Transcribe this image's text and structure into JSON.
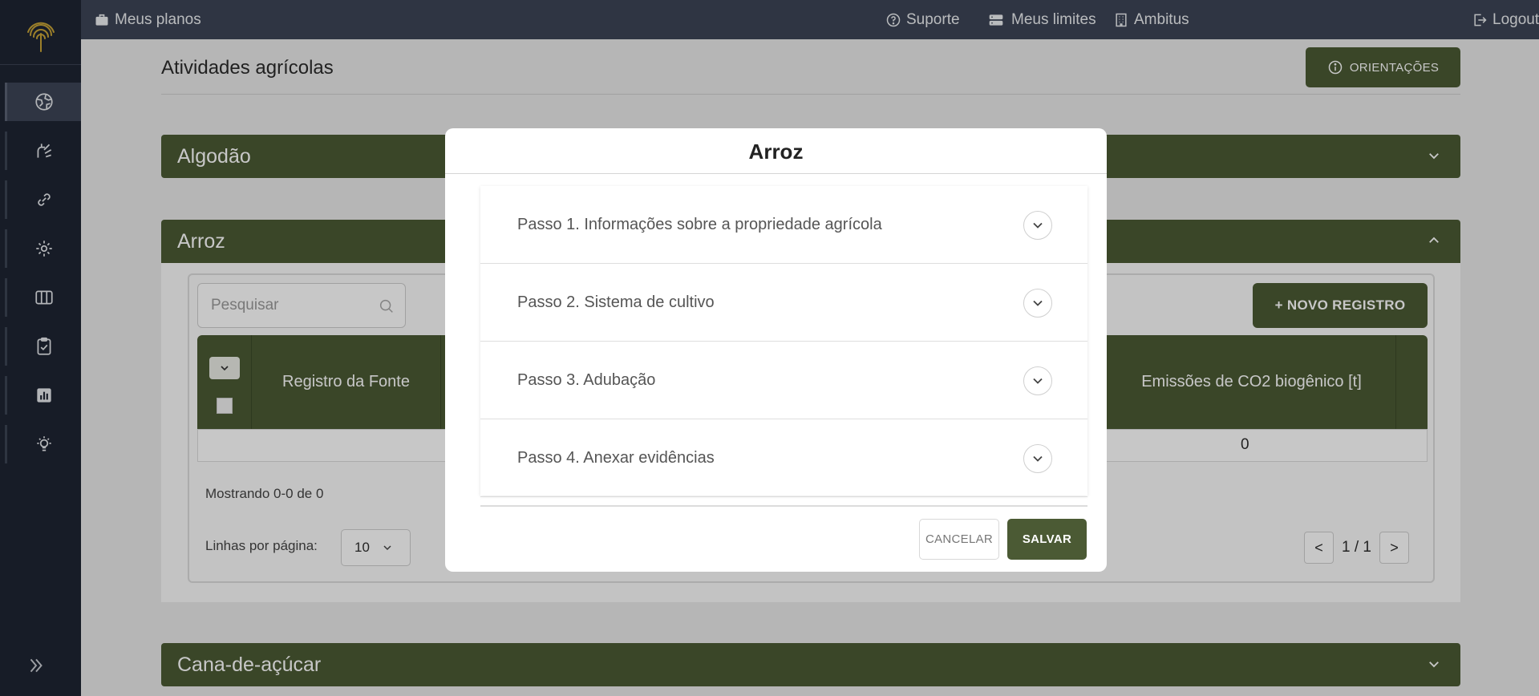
{
  "topbar": {
    "plans": "Meus planos",
    "support": "Suporte",
    "limits": "Meus limites",
    "org": "Ambitus",
    "logout": "Logout"
  },
  "sidebar": {
    "items": [
      {
        "icon": "globe-icon",
        "active": true
      },
      {
        "icon": "factory-icon",
        "active": false
      },
      {
        "icon": "link-icon",
        "active": false
      },
      {
        "icon": "scope-icon",
        "active": false
      },
      {
        "icon": "map-icon",
        "active": false
      },
      {
        "icon": "clipboard-check-icon",
        "active": false
      },
      {
        "icon": "bar-chart-icon",
        "active": false
      },
      {
        "icon": "lightbulb-icon",
        "active": false
      }
    ]
  },
  "page": {
    "title": "Atividades agrícolas",
    "guidance_button": "ORIENTAÇÕES"
  },
  "panels": {
    "cotton": "Algodão",
    "rice": "Arroz",
    "sugarcane": "Cana-de-açúcar"
  },
  "table": {
    "search_placeholder": "Pesquisar",
    "new_record": "+ NOVO REGISTRO",
    "columns": [
      "Registro da Fonte",
      "Emissões de CO2 biogênico [t]"
    ],
    "row_value": "0",
    "showing": "Mostrando 0-0 de 0",
    "rows_per_page_label": "Linhas por página:",
    "rows_per_page": "10",
    "page_info": "1 / 1",
    "prev": "<",
    "next": ">"
  },
  "modal": {
    "title": "Arroz",
    "steps": [
      "Passo 1. Informações sobre a propriedade agrícola",
      "Passo 2. Sistema de cultivo",
      "Passo 3. Adubação",
      "Passo 4. Anexar evidências"
    ],
    "cancel": "CANCELAR",
    "save": "SALVAR"
  },
  "colors": {
    "accent": "#4b5a34",
    "sidebar": "#1e2533",
    "topbar": "#3d4556"
  }
}
